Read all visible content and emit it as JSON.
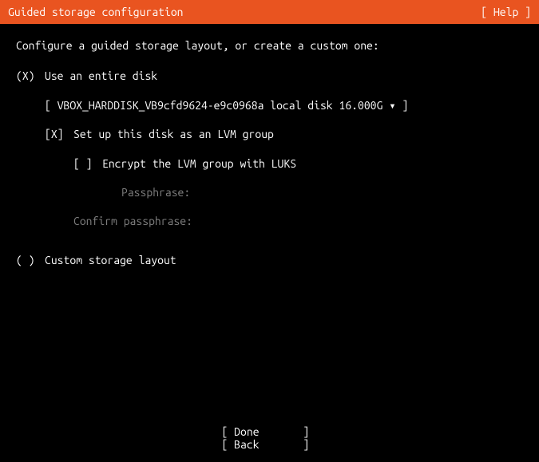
{
  "header": {
    "title": "Guided storage configuration",
    "help": "[ Help ]"
  },
  "instruction": "Configure a guided storage layout, or create a custom one:",
  "options": {
    "entire_disk": {
      "marker": "(X)",
      "label": "Use an entire disk"
    },
    "custom": {
      "marker": "( )",
      "label": "Custom storage layout"
    }
  },
  "disk_selector": {
    "open": "[",
    "value": "VBOX_HARDDISK_VB9cfd9624-e9c0968a local disk 16.000G",
    "arrow": "▾",
    "close": "]"
  },
  "lvm": {
    "marker": "[X]",
    "label": "Set up this disk as an LVM group"
  },
  "encrypt": {
    "marker": "[ ]",
    "label": "Encrypt the LVM group with LUKS"
  },
  "passphrase_label": "Passphrase:",
  "confirm_passphrase_label": "Confirm passphrase:",
  "footer": {
    "done": "[ Done       ]",
    "back": "[ Back       ]"
  }
}
